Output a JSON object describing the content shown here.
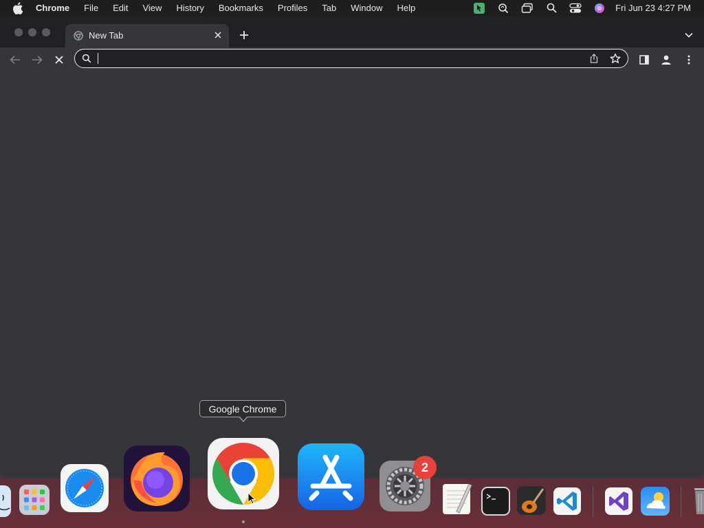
{
  "menubar": {
    "app_name": "Chrome",
    "items": [
      "File",
      "Edit",
      "View",
      "History",
      "Bookmarks",
      "Profiles",
      "Tab",
      "Window",
      "Help"
    ],
    "clock": "Fri Jun 23  4:27 PM",
    "status_icons": [
      "keyboard-maestro-icon",
      "zoom-search-icon",
      "screens-icon",
      "spotlight-icon",
      "control-center-icon",
      "siri-icon"
    ]
  },
  "browser": {
    "tab_title": "New Tab",
    "omnibox_value": "",
    "accent": "#8ab4f8"
  },
  "tooltip": "Google Chrome",
  "dock": {
    "items": [
      "finder",
      "launchpad",
      "safari",
      "firefox",
      "chrome",
      "app-store",
      "system-settings",
      "textedit",
      "terminal",
      "garageband",
      "vscode",
      "visual-studio",
      "weather",
      "trash"
    ],
    "system_settings_badge": "2"
  }
}
